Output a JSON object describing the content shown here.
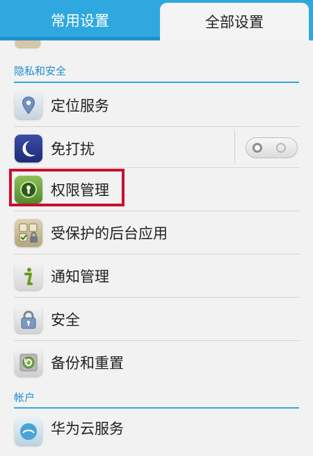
{
  "tabs": {
    "common": "常用设置",
    "all": "全部设置"
  },
  "sections": {
    "privacy": "隐私和安全",
    "accounts": "帐户"
  },
  "items": [
    {
      "label": "定位服务",
      "icon": "location-pin-icon"
    },
    {
      "label": "免打扰",
      "icon": "moon-icon"
    },
    {
      "label": "权限管理",
      "icon": "permission-lock-icon"
    },
    {
      "label": "受保护的后台应用",
      "icon": "protected-apps-icon"
    },
    {
      "label": "通知管理",
      "icon": "info-icon"
    },
    {
      "label": "安全",
      "icon": "padlock-icon"
    },
    {
      "label": "备份和重置",
      "icon": "backup-restore-icon"
    },
    {
      "label": "华为云服务",
      "icon": "cloud-icon"
    }
  ],
  "do_not_disturb": {
    "enabled": false
  },
  "colors": {
    "accent": "#2ea8df",
    "highlight": "#c8102e"
  }
}
